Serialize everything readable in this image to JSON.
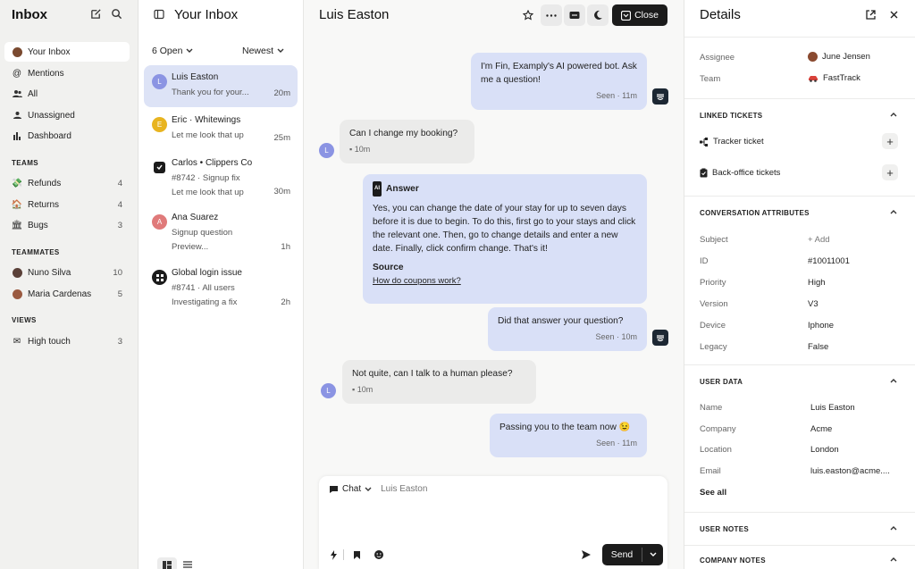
{
  "sidebar": {
    "title": "Inbox",
    "items": [
      {
        "label": "Your Inbox",
        "count": ""
      },
      {
        "label": "Mentions",
        "count": ""
      },
      {
        "label": "All",
        "count": ""
      },
      {
        "label": "Unassigned",
        "count": ""
      },
      {
        "label": "Dashboard",
        "count": ""
      }
    ],
    "teams_heading": "TEAMS",
    "teams": [
      {
        "label": "Refunds",
        "count": "4"
      },
      {
        "label": "Returns",
        "count": "4"
      },
      {
        "label": "Bugs",
        "count": "3"
      }
    ],
    "teammates_heading": "TEAMMATES",
    "teammates": [
      {
        "label": "Nuno Silva",
        "count": "10"
      },
      {
        "label": "Maria Cardenas",
        "count": "5"
      }
    ],
    "views_heading": "VIEWS",
    "views": [
      {
        "label": "High touch",
        "count": "3"
      }
    ]
  },
  "list": {
    "title": "Your Inbox",
    "filter_open": "6 Open",
    "sort": "Newest",
    "conversations": [
      {
        "avatar": "L",
        "name": "Luis Easton",
        "line1": "Thank you for your...",
        "line2": "",
        "time": "20m"
      },
      {
        "avatar": "E",
        "name": "Eric · Whitewings",
        "line1": "Let me look that up",
        "line2": "",
        "time": "25m"
      },
      {
        "avatar": "",
        "name": "Carlos • Clippers Co",
        "line1": "#8742  · Signup fix",
        "line2": "Let me look that up",
        "time": "30m"
      },
      {
        "avatar": "A",
        "name": "Ana Suarez",
        "line1": "Signup question",
        "line2": "Preview...",
        "time": "1h"
      },
      {
        "avatar": "",
        "name": "Global login issue",
        "line1": "#8741 · All users",
        "line2": "Investigating a fix",
        "time": "2h"
      }
    ]
  },
  "conversation": {
    "title": "Luis Easton",
    "close_label": "Close",
    "messages": {
      "m1": {
        "text": "I'm Fin, Examply's AI powered bot. Ask me a question!",
        "meta": "Seen · 11m"
      },
      "m2": {
        "text": "Can I change my booking?",
        "meta": "10m",
        "avatar": "L"
      },
      "m3": {
        "header": "Answer",
        "badge": "AI",
        "text": "Yes, you can change the date of your stay for up to seven days before it is due to begin. To do this, first go to your stays and click the relevant one. Then, go to change details and enter a new date. Finally, click confirm change. That's it!",
        "source_label": "Source",
        "source_link": "How do coupons work?"
      },
      "m4": {
        "text": "Did that answer your question?",
        "meta": "Seen · 10m"
      },
      "m5": {
        "text": "Not quite, can I talk to a human please?",
        "meta": "10m",
        "avatar": "L"
      },
      "m6": {
        "text": "Passing you to the team now 😉",
        "meta": "Seen · 11m"
      }
    },
    "composer": {
      "channel": "Chat",
      "recipient": "Luis Easton",
      "send_label": "Send"
    }
  },
  "details": {
    "title": "Details",
    "assignee_label": "Assignee",
    "assignee_value": "June Jensen",
    "team_label": "Team",
    "team_value": "FastTrack",
    "linked_heading": "LINKED TICKETS",
    "tracker_label": "Tracker ticket",
    "backoffice_label": "Back-office tickets",
    "attributes_heading": "CONVERSATION ATTRIBUTES",
    "attributes": [
      {
        "label": "Subject",
        "value": "+ Add"
      },
      {
        "label": "ID",
        "value": "#10011001"
      },
      {
        "label": "Priority",
        "value": "High"
      },
      {
        "label": "Version",
        "value": "V3"
      },
      {
        "label": "Device",
        "value": "Iphone"
      },
      {
        "label": "Legacy",
        "value": "False"
      }
    ],
    "user_heading": "USER DATA",
    "user_data": [
      {
        "label": "Name",
        "value": "Luis Easton"
      },
      {
        "label": "Company",
        "value": "Acme"
      },
      {
        "label": "Location",
        "value": "London"
      },
      {
        "label": "Email",
        "value": "luis.easton@acme...."
      }
    ],
    "see_all": "See all",
    "notes_heading": "USER NOTES",
    "company_notes_heading": "COMPANY NOTES"
  },
  "colors": {
    "selected": "#dde3f6",
    "bot_bubble": "#d9e0f7",
    "user_bubble": "#ebebea",
    "dark_button": "#1b1b1b",
    "avatar_l": "#8b94e3",
    "avatar_e": "#e8b420",
    "avatar_a": "#e07a7a"
  }
}
